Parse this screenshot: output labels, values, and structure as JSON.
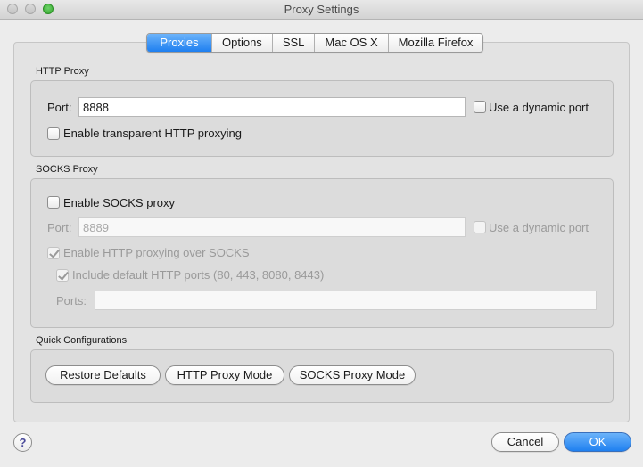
{
  "window": {
    "title": "Proxy Settings"
  },
  "tabs": [
    {
      "label": "Proxies",
      "active": true
    },
    {
      "label": "Options",
      "active": false
    },
    {
      "label": "SSL",
      "active": false
    },
    {
      "label": "Mac OS X",
      "active": false
    },
    {
      "label": "Mozilla Firefox",
      "active": false
    }
  ],
  "http_proxy": {
    "section_title": "HTTP Proxy",
    "port_label": "Port:",
    "port_value": "8888",
    "dynamic_port_label": "Use a dynamic port",
    "dynamic_port_checked": false,
    "transparent_label": "Enable transparent HTTP proxying",
    "transparent_checked": false
  },
  "socks_proxy": {
    "section_title": "SOCKS Proxy",
    "enable_label": "Enable SOCKS proxy",
    "enable_checked": false,
    "port_label": "Port:",
    "port_value": "8889",
    "dynamic_port_label": "Use a dynamic port",
    "http_over_socks_label": "Enable HTTP proxying over SOCKS",
    "http_over_socks_checked": true,
    "include_ports_label": "Include default HTTP ports (80, 443, 8080, 8443)",
    "include_ports_checked": true,
    "ports_label": "Ports:",
    "ports_value": ""
  },
  "quick_config": {
    "section_title": "Quick Configurations",
    "restore_label": "Restore Defaults",
    "http_mode_label": "HTTP Proxy Mode",
    "socks_mode_label": "SOCKS Proxy Mode"
  },
  "footer": {
    "help_label": "?",
    "cancel_label": "Cancel",
    "ok_label": "OK"
  },
  "colors": {
    "accent": "#1e7ff0",
    "panel": "#e3e3e3"
  }
}
